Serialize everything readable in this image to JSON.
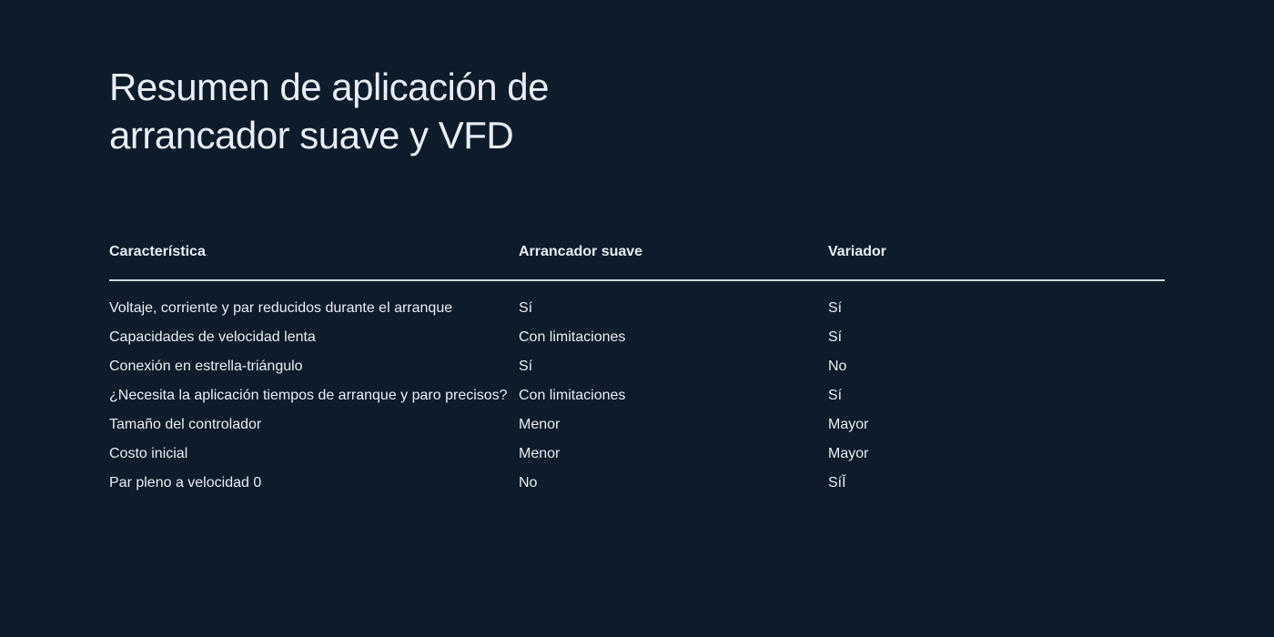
{
  "title": "Resumen de aplicación de arrancador suave y VFD",
  "headers": {
    "feature": "Característica",
    "soft_starter": "Arrancador suave",
    "vfd": "Variador"
  },
  "rows": [
    {
      "feature": "Voltaje, corriente y par reducidos durante el arranque",
      "soft_starter": "Sí",
      "vfd": "Sí"
    },
    {
      "feature": "Capacidades de velocidad lenta",
      "soft_starter": "Con limitaciones",
      "vfd": "Sí"
    },
    {
      "feature": "Conexión en estrella-triángulo",
      "soft_starter": "Sí",
      "vfd": "No"
    },
    {
      "feature": "¿Necesita la aplicación tiempos de arranque y paro precisos?",
      "soft_starter": "Con limitaciones",
      "vfd": "Sí"
    },
    {
      "feature": "Tamaño del controlador",
      "soft_starter": "Menor",
      "vfd": "Mayor"
    },
    {
      "feature": "Costo inicial",
      "soft_starter": "Menor",
      "vfd": "Mayor"
    },
    {
      "feature": "Par pleno a velocidad 0",
      "soft_starter": "No",
      "vfd": "SíǏ"
    }
  ]
}
